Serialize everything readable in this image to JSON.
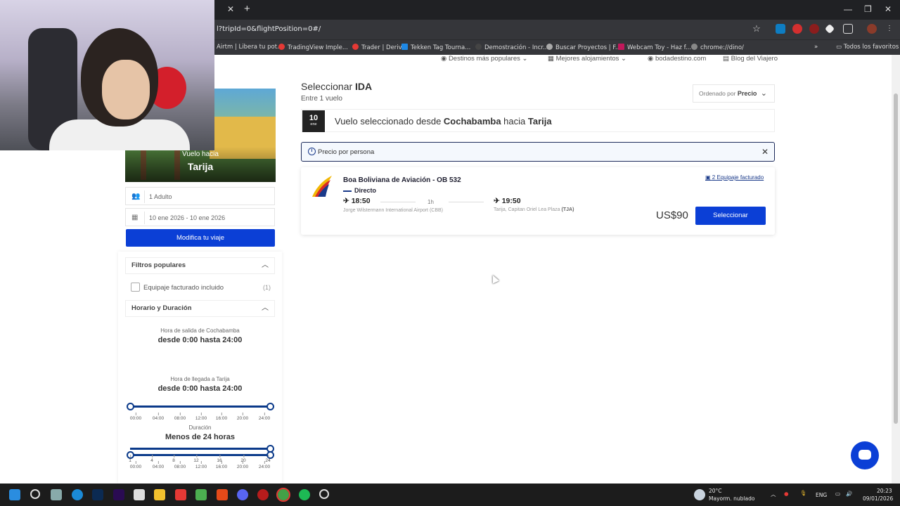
{
  "browser": {
    "url": "l?tripId=0&flightPosition=0#/",
    "bookmarks": [
      "Airtm | Libera tu pot...",
      "TradingView Imple...",
      "Trader | Deriv",
      "Tekken Tag Tourna...",
      "Demostración - Incr...",
      "Buscar Proyectos | F...",
      "Webcam Toy - Haz f...",
      "chrome://dino/"
    ],
    "all_bookmarks": "Todos los favoritos"
  },
  "topnav": {
    "destinos": "Destinos más populares",
    "alojamientos": "Mejores alojamientos",
    "bodadestino": "bodadestino.com",
    "blog": "Blog del Viajero"
  },
  "sidebar": {
    "hero_sub": "Vuelo hacia",
    "hero_title": "Tarija",
    "passengers": "1 Adulto",
    "dates": "10 ene 2026 - 10 ene 2026",
    "modify": "Modifica tu viaje"
  },
  "filters": {
    "popular": "Filtros populares",
    "luggage": "Equipaje facturado incluido",
    "luggage_count": "(1)",
    "schedule": "Horario y Duración",
    "dep_label": "Hora de salida de Cochabamba",
    "dep_value": "desde 0:00 hasta 24:00",
    "arr_label": "Hora de llegada a Tarija",
    "arr_value": "desde 0:00 hasta 24:00",
    "dur_label": "Duración",
    "dur_value": "Menos de 24 horas",
    "hour_ticks": [
      "00:00",
      "04:00",
      "08:00",
      "12:00",
      "16:00",
      "20:00",
      "24:00"
    ],
    "dur_ticks": [
      "1",
      "4",
      "8",
      "12",
      "16",
      "20",
      "24"
    ]
  },
  "main": {
    "title_prefix": "Seleccionar ",
    "title_bold": "IDA",
    "subtitle": "Entre 1 vuelo",
    "order_prefix": "Ordenado por",
    "order_value": "Precio",
    "date_day": "10",
    "date_month": "ene",
    "sel_a": "Vuelo seleccionado desde ",
    "sel_from": "Cochabamba",
    "sel_b": " hacia ",
    "sel_to": "Tarija",
    "info": "Precio por persona"
  },
  "flight": {
    "airline": "Boa Boliviana de Aviación - OB 532",
    "type": "Directo",
    "dep_time": "18:50",
    "arr_time": "19:50",
    "duration": "1h",
    "dep_airport": "Jorge Wilstermann International Airport (CBB)",
    "arr_airport": "Tarija, Capitan Oriel Lea Plaza",
    "arr_code": "(TJA)",
    "luggage": "2 Equipaje facturado",
    "price": "US$90",
    "select": "Seleccionar"
  },
  "taskbar": {
    "weather_temp": "20°C",
    "weather_text": "Mayorm. nublado",
    "lang": "ENG",
    "time": "20:23",
    "date": "09/01/2026"
  }
}
